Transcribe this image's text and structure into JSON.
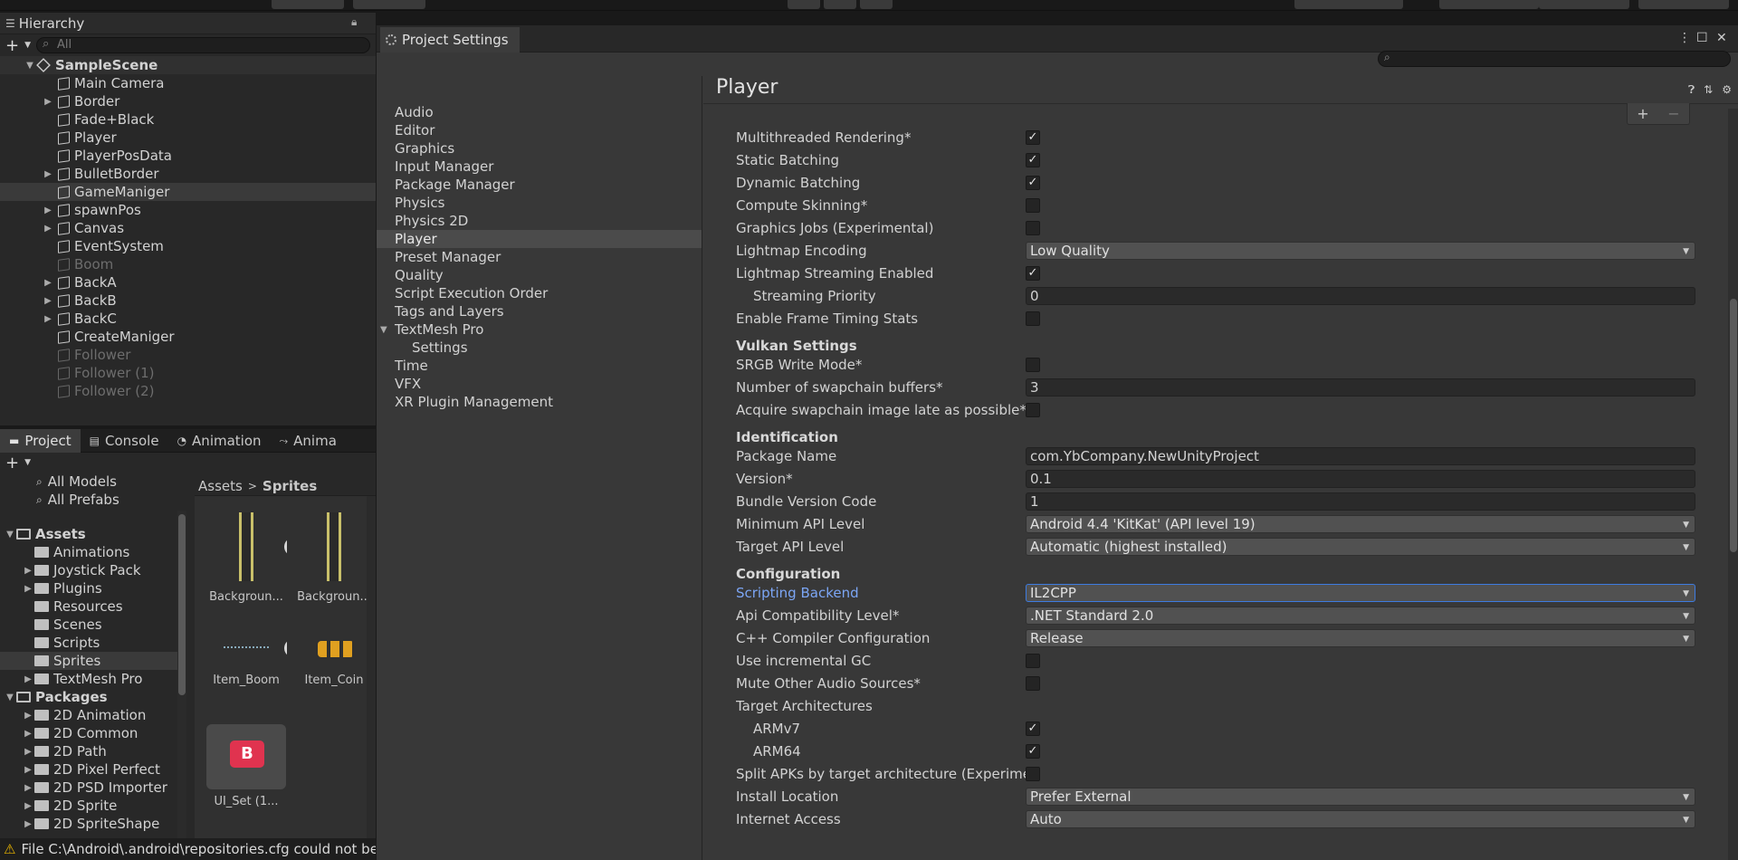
{
  "hierarchy": {
    "tab": "Hierarchy",
    "search_placeholder": "All",
    "scene": "SampleScene",
    "items": [
      {
        "label": "Main Camera",
        "arrow": false,
        "dim": false,
        "sel": false
      },
      {
        "label": "Border",
        "arrow": true,
        "dim": false,
        "sel": false
      },
      {
        "label": "Fade+Black",
        "arrow": false,
        "dim": false,
        "sel": false
      },
      {
        "label": "Player",
        "arrow": false,
        "dim": false,
        "sel": false
      },
      {
        "label": "PlayerPosData",
        "arrow": false,
        "dim": false,
        "sel": false
      },
      {
        "label": "BulletBorder",
        "arrow": true,
        "dim": false,
        "sel": false
      },
      {
        "label": "GameManiger",
        "arrow": false,
        "dim": false,
        "sel": true
      },
      {
        "label": "spawnPos",
        "arrow": true,
        "dim": false,
        "sel": false
      },
      {
        "label": "Canvas",
        "arrow": true,
        "dim": false,
        "sel": false
      },
      {
        "label": "EventSystem",
        "arrow": false,
        "dim": false,
        "sel": false
      },
      {
        "label": "Boom",
        "arrow": false,
        "dim": true,
        "sel": false
      },
      {
        "label": "BackA",
        "arrow": true,
        "dim": false,
        "sel": false
      },
      {
        "label": "BackB",
        "arrow": true,
        "dim": false,
        "sel": false
      },
      {
        "label": "BackC",
        "arrow": true,
        "dim": false,
        "sel": false
      },
      {
        "label": "CreateManiger",
        "arrow": false,
        "dim": false,
        "sel": false
      },
      {
        "label": "Follower",
        "arrow": false,
        "dim": true,
        "sel": false
      },
      {
        "label": "Follower (1)",
        "arrow": false,
        "dim": true,
        "sel": false
      },
      {
        "label": "Follower (2)",
        "arrow": false,
        "dim": true,
        "sel": false
      }
    ]
  },
  "project": {
    "tabs": [
      "Project",
      "Console",
      "Animation",
      "Anima"
    ],
    "favorites": [
      "All Models",
      "All Prefabs"
    ],
    "assets_root": "Assets",
    "asset_folders": [
      {
        "label": "Animations",
        "arrow": false,
        "sel": false
      },
      {
        "label": "Joystick Pack",
        "arrow": true,
        "sel": false
      },
      {
        "label": "Plugins",
        "arrow": true,
        "sel": false
      },
      {
        "label": "Resources",
        "arrow": false,
        "sel": false
      },
      {
        "label": "Scenes",
        "arrow": false,
        "sel": false
      },
      {
        "label": "Scripts",
        "arrow": false,
        "sel": false
      },
      {
        "label": "Sprites",
        "arrow": false,
        "sel": true
      },
      {
        "label": "TextMesh Pro",
        "arrow": true,
        "sel": false
      }
    ],
    "packages_root": "Packages",
    "packages": [
      "2D Animation",
      "2D Common",
      "2D Path",
      "2D Pixel Perfect",
      "2D PSD Importer",
      "2D Sprite",
      "2D SpriteShape"
    ],
    "breadcrumb": [
      "Assets",
      "Sprites"
    ],
    "assets": [
      "Backgroun...",
      "Backgroun...",
      "Item_Boom",
      "Item_Coin",
      "UI_Set (1..."
    ]
  },
  "status": {
    "text": "File C:\\Android\\.android\\repositories.cfg could not be l"
  },
  "settings": {
    "window_title": "Project Settings",
    "nav": [
      {
        "label": "Audio",
        "sel": false,
        "sub": false,
        "arrow": false
      },
      {
        "label": "Editor",
        "sel": false,
        "sub": false,
        "arrow": false
      },
      {
        "label": "Graphics",
        "sel": false,
        "sub": false,
        "arrow": false
      },
      {
        "label": "Input Manager",
        "sel": false,
        "sub": false,
        "arrow": false
      },
      {
        "label": "Package Manager",
        "sel": false,
        "sub": false,
        "arrow": false
      },
      {
        "label": "Physics",
        "sel": false,
        "sub": false,
        "arrow": false
      },
      {
        "label": "Physics 2D",
        "sel": false,
        "sub": false,
        "arrow": false
      },
      {
        "label": "Player",
        "sel": true,
        "sub": false,
        "arrow": false
      },
      {
        "label": "Preset Manager",
        "sel": false,
        "sub": false,
        "arrow": false
      },
      {
        "label": "Quality",
        "sel": false,
        "sub": false,
        "arrow": false
      },
      {
        "label": "Script Execution Order",
        "sel": false,
        "sub": false,
        "arrow": false
      },
      {
        "label": "Tags and Layers",
        "sel": false,
        "sub": false,
        "arrow": false
      },
      {
        "label": "TextMesh Pro",
        "sel": false,
        "sub": false,
        "arrow": true
      },
      {
        "label": "Settings",
        "sel": false,
        "sub": true,
        "arrow": false
      },
      {
        "label": "Time",
        "sel": false,
        "sub": false,
        "arrow": false
      },
      {
        "label": "VFX",
        "sel": false,
        "sub": false,
        "arrow": false
      },
      {
        "label": "XR Plugin Management",
        "sel": false,
        "sub": false,
        "arrow": false
      }
    ],
    "page_title": "Player",
    "rows": [
      {
        "kind": "check",
        "label": "Multithreaded Rendering*",
        "checked": true
      },
      {
        "kind": "check",
        "label": "Static Batching",
        "checked": true
      },
      {
        "kind": "check",
        "label": "Dynamic Batching",
        "checked": true
      },
      {
        "kind": "check",
        "label": "Compute Skinning*",
        "checked": false
      },
      {
        "kind": "check",
        "label": "Graphics Jobs (Experimental)",
        "checked": false
      },
      {
        "kind": "dropdown",
        "label": "Lightmap Encoding",
        "value": "Low Quality"
      },
      {
        "kind": "check",
        "label": "Lightmap Streaming Enabled",
        "checked": true
      },
      {
        "kind": "field",
        "label": "Streaming Priority",
        "value": "0",
        "indent": true
      },
      {
        "kind": "check",
        "label": "Enable Frame Timing Stats",
        "checked": false
      },
      {
        "kind": "section",
        "label": "Vulkan Settings"
      },
      {
        "kind": "check",
        "label": "SRGB Write Mode*",
        "checked": false
      },
      {
        "kind": "field",
        "label": "Number of swapchain buffers*",
        "value": "3"
      },
      {
        "kind": "check",
        "label": "Acquire swapchain image late as possible*",
        "checked": false
      },
      {
        "kind": "section",
        "label": "Identification"
      },
      {
        "kind": "field",
        "label": "Package Name",
        "value": "com.YbCompany.NewUnityProject"
      },
      {
        "kind": "field",
        "label": "Version*",
        "value": "0.1"
      },
      {
        "kind": "field",
        "label": "Bundle Version Code",
        "value": "1"
      },
      {
        "kind": "dropdown",
        "label": "Minimum API Level",
        "value": "Android 4.4 'KitKat' (API level 19)"
      },
      {
        "kind": "dropdown",
        "label": "Target API Level",
        "value": "Automatic (highest installed)"
      },
      {
        "kind": "section",
        "label": "Configuration"
      },
      {
        "kind": "dropdown",
        "label": "Scripting Backend",
        "value": "IL2CPP",
        "focus": true
      },
      {
        "kind": "dropdown",
        "label": "Api Compatibility Level*",
        "value": ".NET Standard 2.0"
      },
      {
        "kind": "dropdown",
        "label": "C++ Compiler Configuration",
        "value": "Release"
      },
      {
        "kind": "check",
        "label": "Use incremental GC",
        "checked": false
      },
      {
        "kind": "check",
        "label": "Mute Other Audio Sources*",
        "checked": false
      },
      {
        "kind": "label",
        "label": "Target Architectures"
      },
      {
        "kind": "check",
        "label": "ARMv7",
        "checked": true,
        "indent": true
      },
      {
        "kind": "check",
        "label": "ARM64",
        "checked": true,
        "indent": true
      },
      {
        "kind": "check",
        "label": "Split APKs by target architecture (Experimental)",
        "checked": false
      },
      {
        "kind": "dropdown",
        "label": "Install Location",
        "value": "Prefer External"
      },
      {
        "kind": "dropdown",
        "label": "Internet Access",
        "value": "Auto"
      }
    ]
  }
}
